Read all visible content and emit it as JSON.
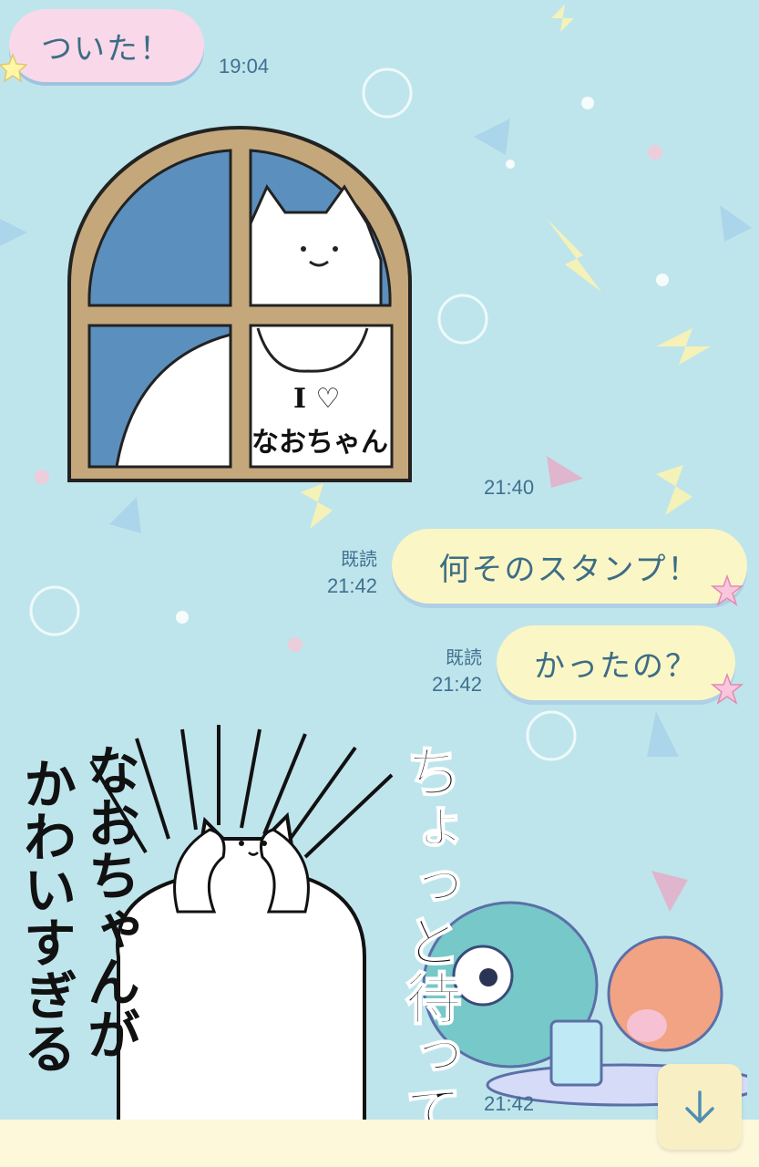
{
  "messages": [
    {
      "text": "ついた！",
      "time": "19:04"
    },
    {
      "time": "21:40",
      "sticker": "cat-window",
      "sticker_text": "I ♡\nなおちゃん"
    },
    {
      "text": "何そのスタンプ！",
      "read": "既読",
      "time": "21:42"
    },
    {
      "text": "かったの？",
      "read": "既読",
      "time": "21:42"
    },
    {
      "time": "21:42",
      "sticker": "cat-shock",
      "sticker_text_1": "ちょっと待って",
      "sticker_text_2": "なおちゃんが",
      "sticker_text_3": "かわいすぎる"
    }
  ],
  "sticker1": {
    "line1": "I ♡",
    "line2": "なおちゃん"
  },
  "sticker2": {
    "col1": "ちょっと待って",
    "col2": "なおちゃんが",
    "col3": "かわいすぎる"
  },
  "icons": {
    "scroll": "arrow-down-icon",
    "star": "star-icon"
  },
  "colors": {
    "background": "#bfe5ec",
    "bubble_in": "#f9d8ea",
    "bubble_out": "#fbf6c6",
    "text": "#3c6d85"
  }
}
